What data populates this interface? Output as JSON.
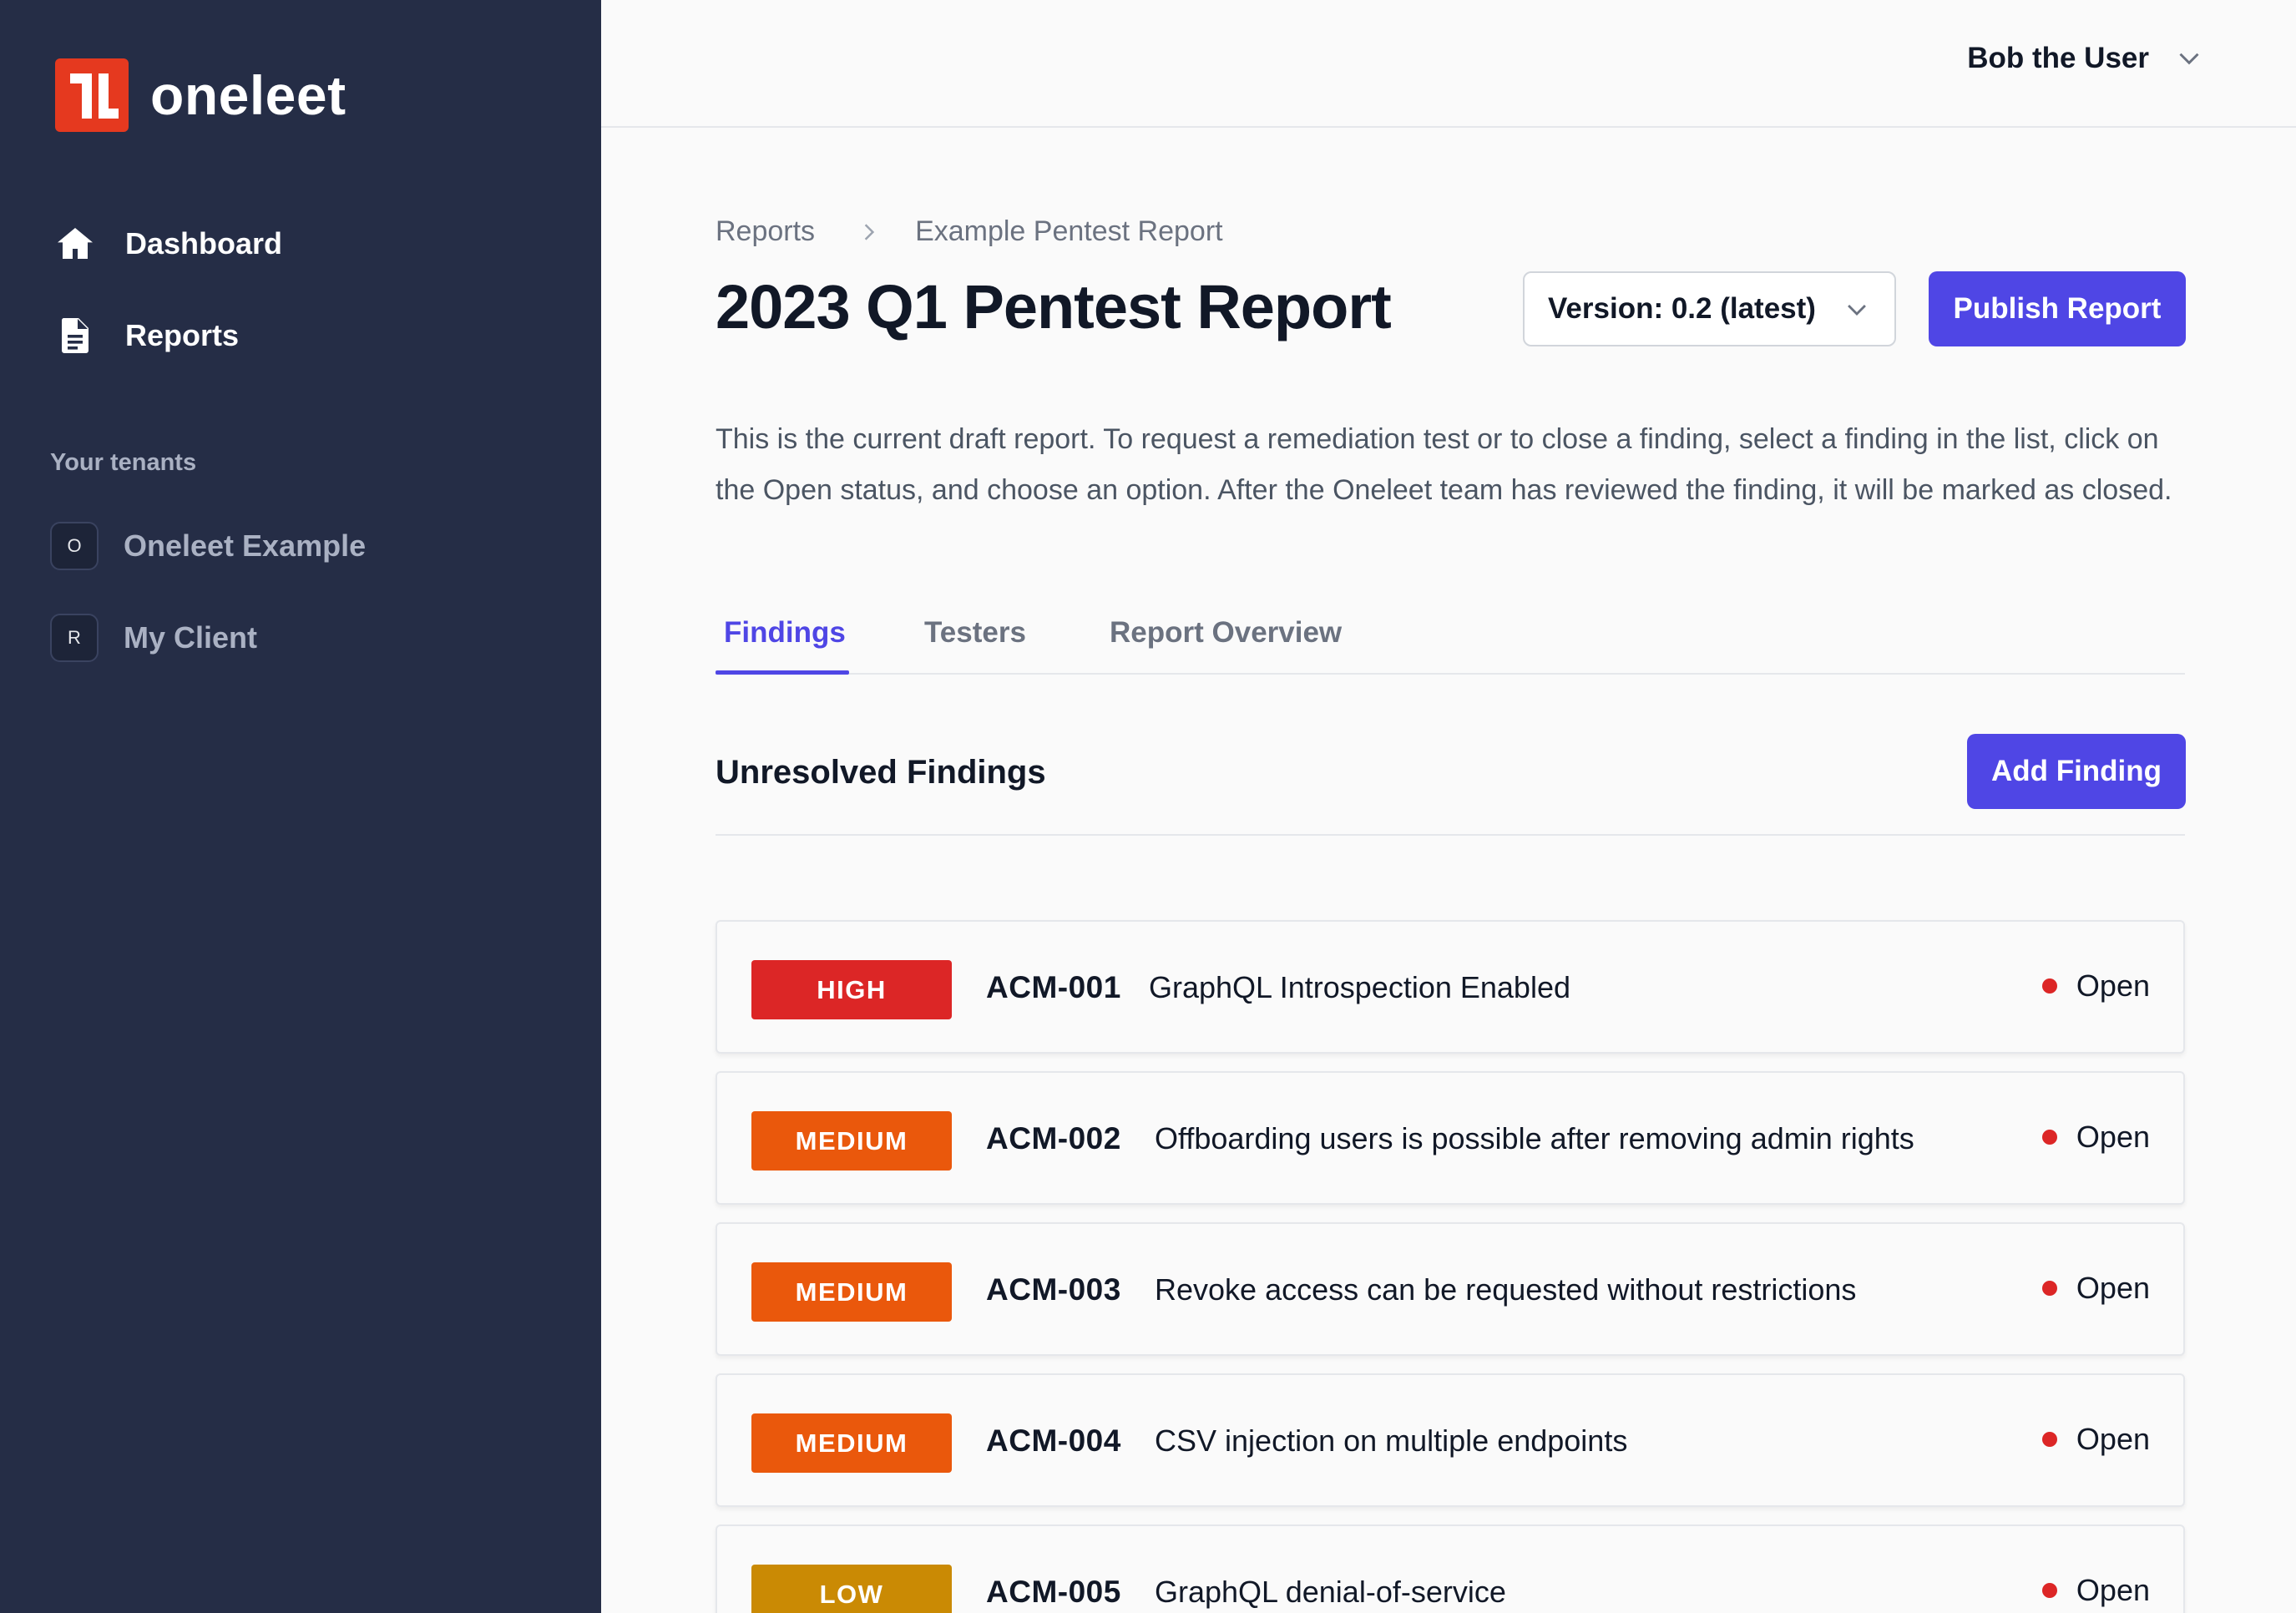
{
  "app": {
    "name": "oneleet",
    "accent": "#4f46e5",
    "logo_color": "#e5391f"
  },
  "sidebar": {
    "items": [
      {
        "label": "Dashboard",
        "icon": "home-icon"
      },
      {
        "label": "Reports",
        "icon": "document-icon"
      }
    ],
    "tenants_title": "Your tenants",
    "tenants": [
      {
        "initial": "O",
        "label": "Oneleet Example"
      },
      {
        "initial": "R",
        "label": "My Client"
      }
    ]
  },
  "header": {
    "user_name": "Bob the User"
  },
  "breadcrumb": [
    "Reports",
    "Example Pentest Report"
  ],
  "page": {
    "title": "2023 Q1 Pentest Report",
    "version_label": "Version: 0.2 (latest)",
    "publish_label": "Publish Report",
    "description": "This is the current draft report. To request a remediation test or to close a finding, select a finding in the list, click on the Open status, and choose an option. After the Oneleet team has reviewed the finding, it will be marked as closed."
  },
  "tabs": [
    {
      "label": "Findings",
      "active": true
    },
    {
      "label": "Testers",
      "active": false
    },
    {
      "label": "Report Overview",
      "active": false
    }
  ],
  "section": {
    "title": "Unresolved Findings",
    "add_label": "Add Finding"
  },
  "findings": [
    {
      "severity": "HIGH",
      "id": "ACM-001",
      "title": "GraphQL Introspection Enabled",
      "status": "Open"
    },
    {
      "severity": "MEDIUM",
      "id": "ACM-002",
      "title": "Offboarding users is possible after removing admin rights",
      "status": "Open"
    },
    {
      "severity": "MEDIUM",
      "id": "ACM-003",
      "title": "Revoke access can be requested without restrictions",
      "status": "Open"
    },
    {
      "severity": "MEDIUM",
      "id": "ACM-004",
      "title": "CSV injection on multiple endpoints",
      "status": "Open"
    },
    {
      "severity": "LOW",
      "id": "ACM-005",
      "title": "GraphQL denial-of-service",
      "status": "Open"
    }
  ],
  "severity_colors": {
    "HIGH": "#dc2626",
    "MEDIUM": "#ea580c",
    "LOW": "#ca8a04"
  }
}
